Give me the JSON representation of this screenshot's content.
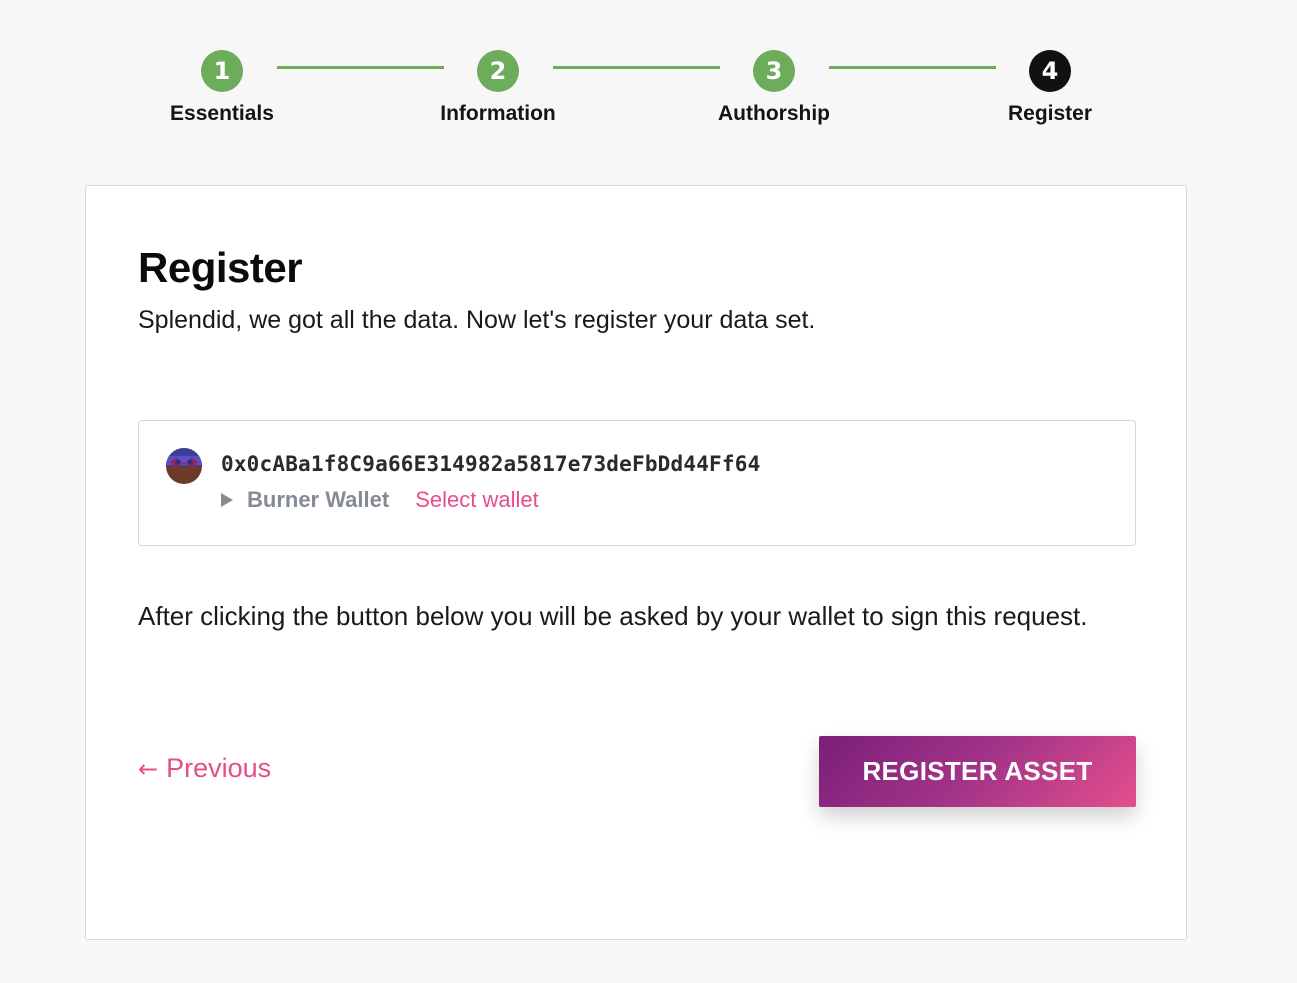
{
  "colors": {
    "step_done": "#6cac5a",
    "step_active": "#111111",
    "accent_pink": "#e74c8b",
    "button_gradient_start": "#7a1f78",
    "button_gradient_end": "#e44f8c",
    "muted_text": "#858b94"
  },
  "stepper": {
    "steps": [
      {
        "number": "1",
        "label": "Essentials",
        "state": "done"
      },
      {
        "number": "2",
        "label": "Information",
        "state": "done"
      },
      {
        "number": "3",
        "label": "Authorship",
        "state": "done"
      },
      {
        "number": "4",
        "label": "Register",
        "state": "active"
      }
    ]
  },
  "card": {
    "title": "Register",
    "lead": "Splendid, we got all the data. Now let's register your data set.",
    "wallet": {
      "avatar_icon": "wallet-identicon",
      "address": "0x0cABa1f8C9a66E314982a5817e73deFbDd44Ff64",
      "toggle_icon": "triangle-right-icon",
      "name": "Burner Wallet",
      "select_label": "Select wallet"
    },
    "info": "After clicking the button below you will be asked by your wallet to sign this request.",
    "previous": {
      "arrow": "←",
      "label": "Previous"
    },
    "register_button": "REGISTER ASSET"
  }
}
